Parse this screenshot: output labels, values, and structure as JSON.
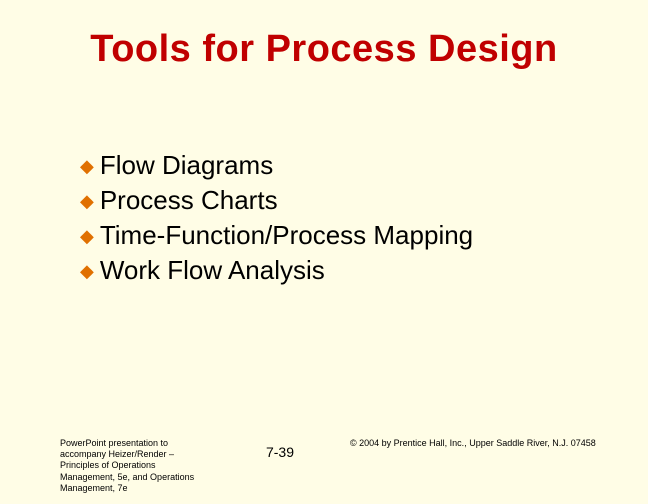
{
  "title": "Tools for Process Design",
  "bullets": [
    "Flow Diagrams",
    "Process Charts",
    "Time-Function/Process Mapping",
    "Work Flow Analysis"
  ],
  "footer": {
    "left": "PowerPoint presentation to accompany Heizer/Render – Principles of Operations Management, 5e, and Operations Management, 7e",
    "center": "7-39",
    "right": "© 2004 by Prentice Hall, Inc., Upper Saddle River, N.J. 07458"
  }
}
